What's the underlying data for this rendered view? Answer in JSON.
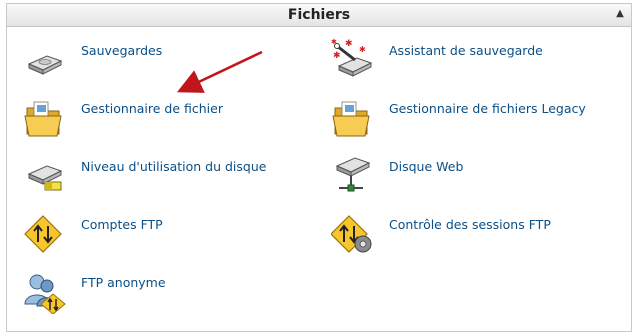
{
  "panel": {
    "title": "Fichiers",
    "collapse_glyph": "▲"
  },
  "items": [
    {
      "label": "Sauvegardes",
      "icon": "backup-drive-icon"
    },
    {
      "label": "Assistant de sauvegarde",
      "icon": "backup-wizard-icon"
    },
    {
      "label": "Gestionnaire de fichier",
      "icon": "file-manager-folder-icon"
    },
    {
      "label": "Gestionnaire de fichiers Legacy",
      "icon": "legacy-file-manager-folder-icon"
    },
    {
      "label": "Niveau d'utilisation du disque",
      "icon": "disk-usage-icon"
    },
    {
      "label": "Disque Web",
      "icon": "web-disk-icon"
    },
    {
      "label": "Comptes FTP",
      "icon": "ftp-accounts-icon"
    },
    {
      "label": "Contrôle des sessions FTP",
      "icon": "ftp-session-control-icon"
    },
    {
      "label": "FTP anonyme",
      "icon": "anonymous-ftp-icon"
    }
  ],
  "colors": {
    "link": "#0b4f86",
    "annotation_arrow": "#c0161b"
  }
}
